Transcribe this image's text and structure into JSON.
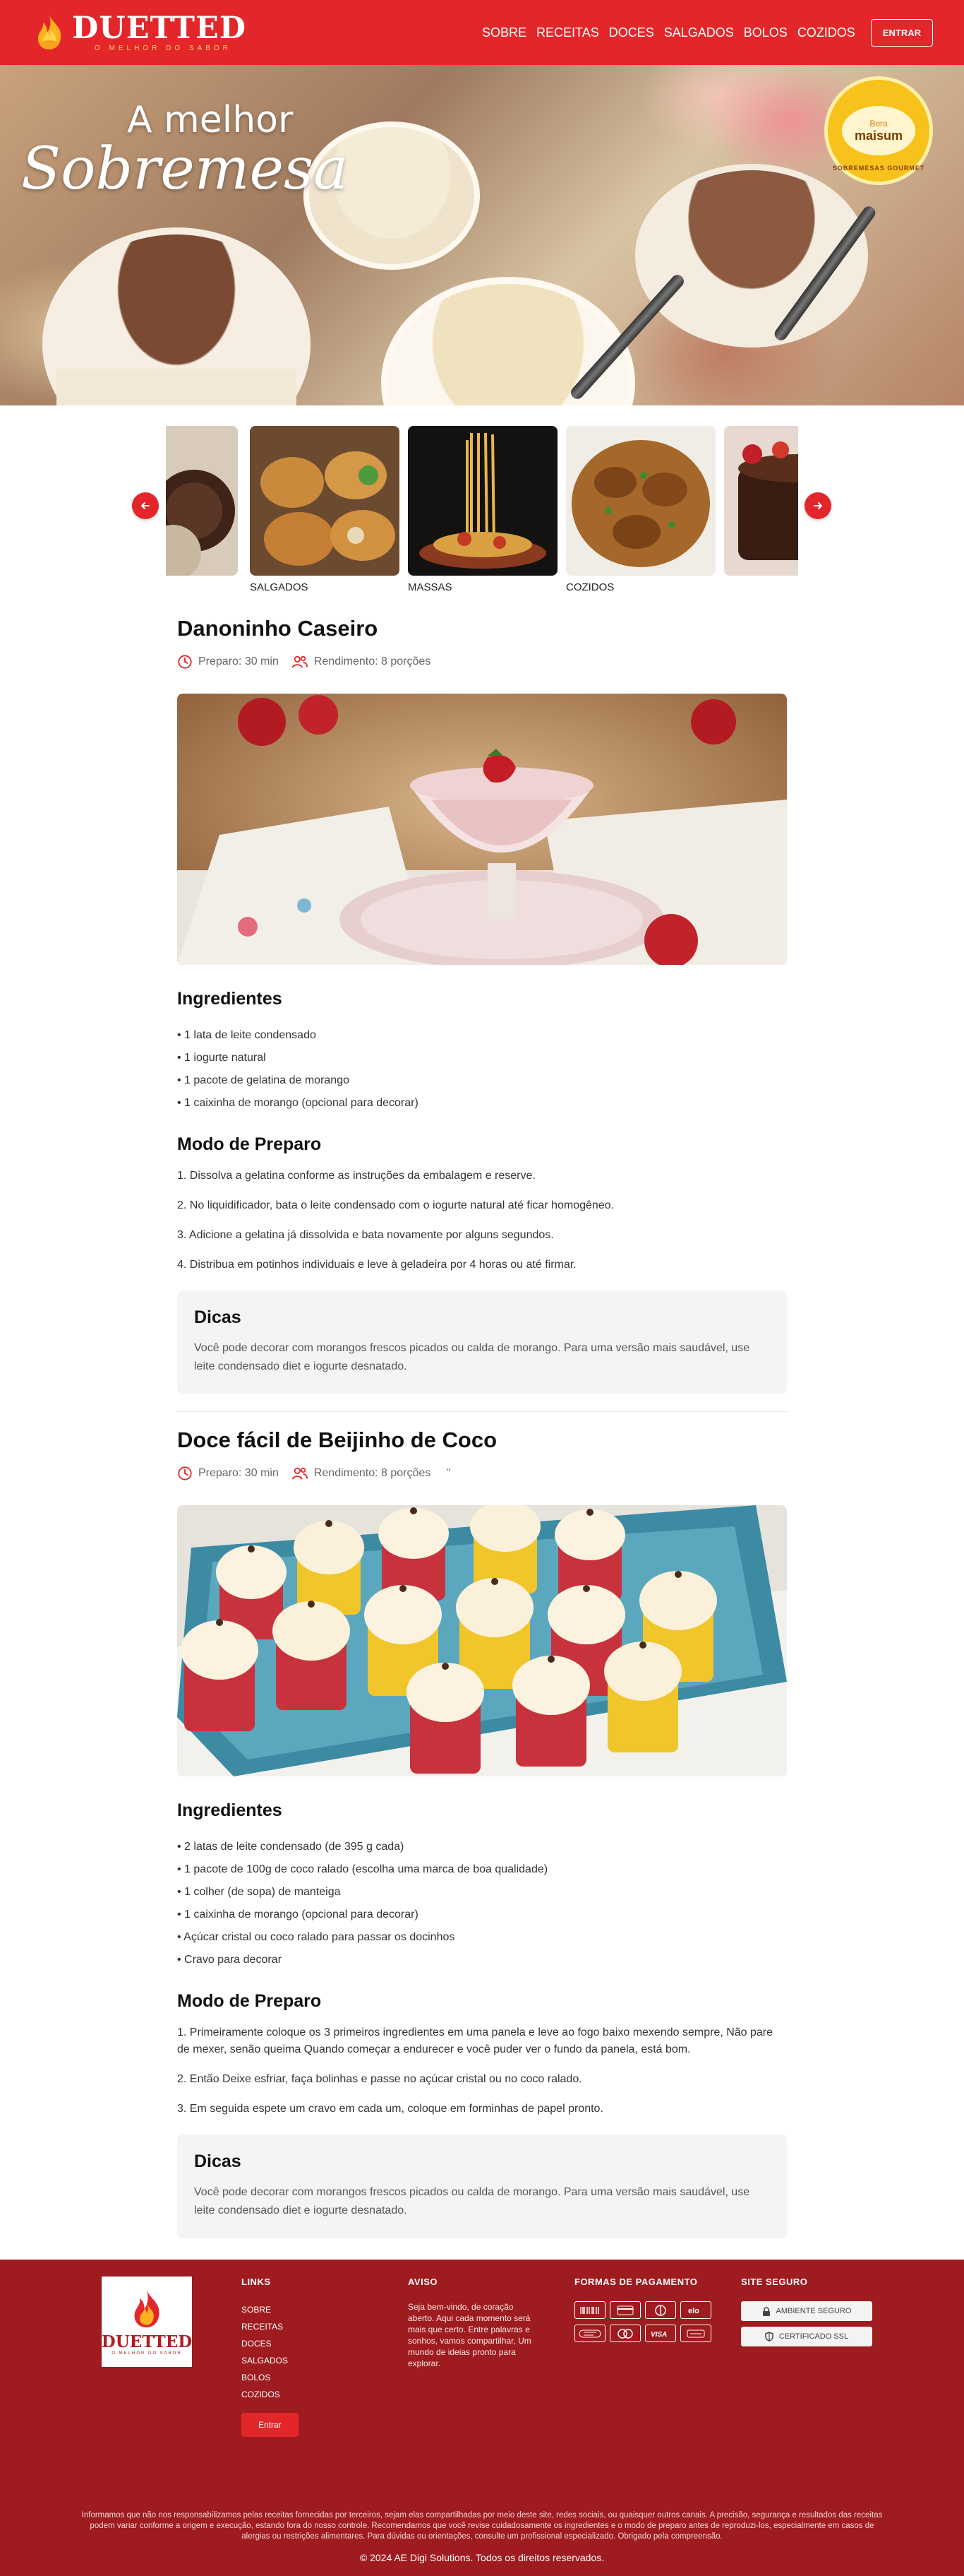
{
  "header": {
    "brand": "DUETTED",
    "tagline": "O MELHOR DO SABOR",
    "nav": [
      "SOBRE",
      "RECEITAS",
      "DOCES",
      "SALGADOS",
      "BOLOS",
      "COZIDOS"
    ],
    "login_label": "ENTRAR"
  },
  "hero": {
    "line1": "A melhor",
    "line2": "Sobremesa",
    "seal_top": "Bora",
    "seal_mid": "maisum",
    "seal_ring": "SOBREMESAS GOURMET"
  },
  "carousel": {
    "categories": [
      "",
      "SALGADOS",
      "MASSAS",
      "COZIDOS",
      ""
    ],
    "prev_icon": "arrow-left-icon",
    "next_icon": "arrow-right-icon"
  },
  "recipes": [
    {
      "title": "Danoninho Caseiro",
      "prep": "Preparo: 30 min",
      "yield": "Rendimento: 8 porções",
      "extra": "",
      "ingredients_title": "Ingredientes",
      "ingredients": [
        "1 lata de leite condensado",
        "1 iogurte natural",
        "1 pacote de gelatina de morango",
        "1 caixinha de morango (opcional para decorar)"
      ],
      "method_title": "Modo de Preparo",
      "steps": [
        "1. Dissolva a gelatina conforme as instruções da embalagem e reserve.",
        "2. No liquidificador, bata o leite condensado com o iogurte natural até ficar homogêneo.",
        "3. Adicione a gelatina já dissolvida e bata novamente por alguns segundos.",
        "4. Distribua em potinhos individuais e leve à geladeira por 4 horas ou até firmar."
      ],
      "tips_title": "Dicas",
      "tips": "Você pode decorar com morangos frescos picados ou calda de morango. Para uma versão mais saudável, use leite condensado diet e iogurte desnatado."
    },
    {
      "title": "Doce fácil de Beijinho de Coco",
      "prep": "Preparo: 30 min",
      "yield": "Rendimento: 8 porções",
      "extra": "''",
      "ingredients_title": "Ingredientes",
      "ingredients": [
        "2 latas de leite condensado (de 395 g cada)",
        "1 pacote de 100g de coco ralado (escolha uma marca de boa qualidade)",
        "1 colher (de sopa) de manteiga",
        "1 caixinha de morango (opcional para decorar)",
        "Açúcar cristal ou coco ralado para passar os docinhos",
        "Cravo para decorar"
      ],
      "method_title": "Modo de Preparo",
      "steps": [
        "1. Primeiramente coloque os 3 primeiros ingredientes em uma panela e leve ao fogo baixo mexendo sempre, Não pare de mexer, senão queima Quando começar a endurecer e você puder ver o fundo da panela, está bom.",
        "2. Então Deixe esfriar, faça bolinhas e passe no açúcar cristal ou no coco ralado.",
        "3. Em seguida espete um cravo em cada um, coloque em forminhas de papel pronto."
      ],
      "tips_title": "Dicas",
      "tips": "Você pode decorar com morangos frescos picados ou calda de morango. Para uma versão mais saudável, use leite condensado diet e iogurte desnatado."
    }
  ],
  "footer": {
    "logo_brand": "DUETTED",
    "logo_tagline": "O MELHOR DO SABOR",
    "links_title": "LINKS",
    "links": [
      "SOBRE",
      "RECEITAS",
      "DOCES",
      "SALGADOS",
      "BOLOS",
      "COZIDOS"
    ],
    "login_label": "Entrar",
    "aviso_title": "AVISO",
    "aviso_text": "Seja bem-vindo, de coração aberto. Aqui cada momento será mais que certo. Entre palavras e sonhos, vamos compartilhar, Um mundo de ideias pronto para explorar.",
    "payment_title": "FORMAS DE PAGAMENTO",
    "payments": [
      "BOLETO",
      "CARD",
      "DINERS",
      "elo",
      "HIPER",
      "MASTER",
      "VISA",
      "CARD"
    ],
    "secure_title": "SITE SEGURO",
    "secure_1": "AMBIENTE SEGURO",
    "secure_2": "CERTIFICADO SSL",
    "disclaimer": "Informamos que não nos responsabilizamos pelas receitas fornecidas por terceiros, sejam elas compartilhadas por meio deste site, redes sociais, ou quaisquer outros canais. A precisão, segurança e resultados das receitas podem variar conforme a origem e execução, estando fora do nosso controle. Recomendamos que você revise cuidadosamente os ingredientes e o modo de preparo antes de reproduzi-los, especialmente em casos de alergias ou restrições alimentares. Para dúvidas ou orientações, consulte um profissional especializado. Obrigado pela compreensão.",
    "copyright": "© 2024 AE Digi Solutions. Todos os direitos reservados."
  },
  "colors": {
    "brand_red": "#e3262a",
    "footer_red": "#9e1b1f",
    "tips_bg": "#f3f4f6"
  }
}
